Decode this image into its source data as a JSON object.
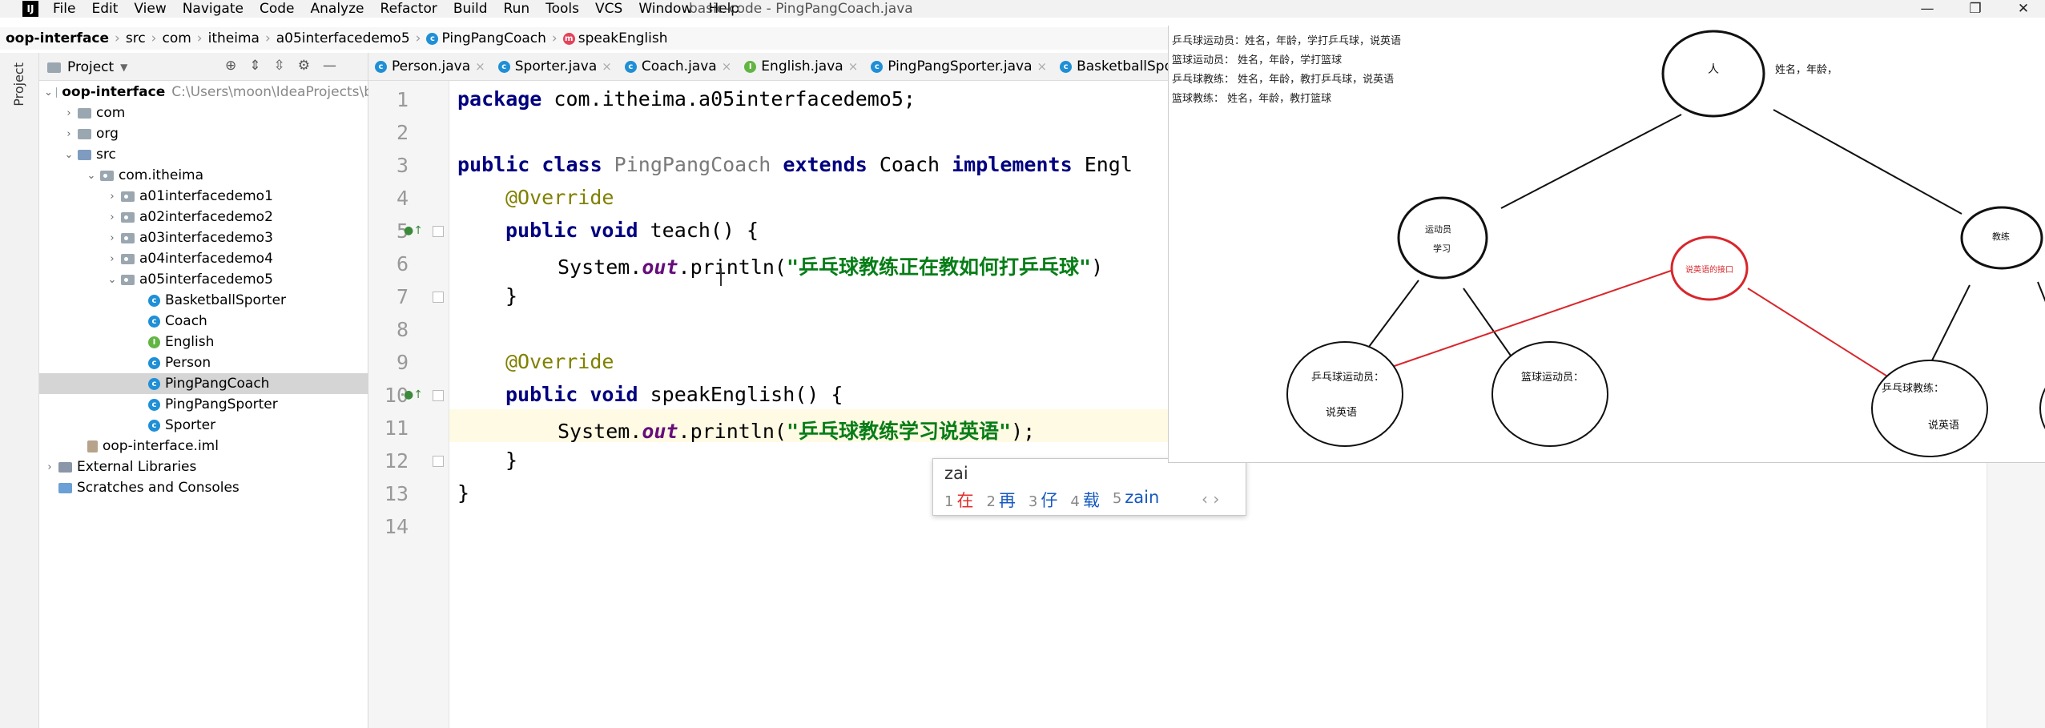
{
  "window": {
    "title": "basic-code - PingPangCoach.java",
    "menus": [
      "File",
      "Edit",
      "View",
      "Navigate",
      "Code",
      "Analyze",
      "Refactor",
      "Build",
      "Run",
      "Tools",
      "VCS",
      "Window",
      "Help"
    ]
  },
  "breadcrumb": [
    "oop-interface",
    "src",
    "com",
    "itheima",
    "a05interfacedemo5",
    "PingPangCoach",
    "speakEnglish"
  ],
  "side_stripe": {
    "label": "Project"
  },
  "project": {
    "title": "Project",
    "tree": [
      {
        "label": "oop-interface",
        "path": "C:\\Users\\moon\\IdeaProjects\\b"
      },
      {
        "label": "com"
      },
      {
        "label": "org"
      },
      {
        "label": "src"
      },
      {
        "label": "com.itheima"
      },
      {
        "label": "a01interfacedemo1"
      },
      {
        "label": "a02interfacedemo2"
      },
      {
        "label": "a03interfacedemo3"
      },
      {
        "label": "a04interfacedemo4"
      },
      {
        "label": "a05interfacedemo5"
      },
      {
        "label": "BasketballSporter"
      },
      {
        "label": "Coach"
      },
      {
        "label": "English"
      },
      {
        "label": "Person"
      },
      {
        "label": "PingPangCoach"
      },
      {
        "label": "PingPangSporter"
      },
      {
        "label": "Sporter"
      },
      {
        "label": "oop-interface.iml"
      },
      {
        "label": "External Libraries"
      },
      {
        "label": "Scratches and Consoles"
      }
    ]
  },
  "tabs": [
    "Person.java",
    "Sporter.java",
    "Coach.java",
    "English.java",
    "PingPangSporter.java",
    "BasketballSporte"
  ],
  "code": {
    "line_numbers": [
      "1",
      "2",
      "3",
      "4",
      "5",
      "6",
      "7",
      "8",
      "9",
      "10",
      "11",
      "12",
      "13",
      "14"
    ],
    "l1": {
      "kw": "package",
      "rest": " com.itheima.a05interfacedemo5;"
    },
    "l3": {
      "kw1": "public class ",
      "cls": "PingPangCoach",
      "kw2": " extends ",
      "t1": "Coach",
      "kw3": " implements ",
      "t2": "Engl"
    },
    "l4": "@Override",
    "l5": {
      "kw": "public void ",
      "rest": "teach() {"
    },
    "l6": {
      "a": "System.",
      "fld": "out",
      "b": ".println(",
      "str": "\"乒乓球教练正在教如何打乒乓球\"",
      "c": ")"
    },
    "l7": "}",
    "l9": "@Override",
    "l10": {
      "kw": "public void ",
      "rest": "speakEnglish() {"
    },
    "l11": {
      "a": "System.",
      "fld": "out",
      "b": ".println(",
      "str": "\"乒乓球教练学习说英语\"",
      "c": ");"
    },
    "l12": "}",
    "l13": "}"
  },
  "ime": {
    "input": "zai",
    "candidates": [
      {
        "num": "1",
        "text": "在"
      },
      {
        "num": "2",
        "text": "再"
      },
      {
        "num": "3",
        "text": "仔"
      },
      {
        "num": "4",
        "text": "载"
      },
      {
        "num": "5",
        "text": "zain"
      }
    ],
    "nav": "‹ ›"
  },
  "diagram": {
    "notes": [
      "乒乓球运动员：姓名，年龄，学打乒乓球，说英语",
      "篮球运动员：   姓名，年龄，学打篮球",
      "乒乓球教练：   姓名，年龄，教打乒乓球，说英语",
      "篮球教练：      姓名，年龄，教打篮球"
    ],
    "root": "人",
    "root_attr": "姓名，年龄，",
    "athlete": "运动员",
    "athlete_sub": "学习",
    "coach": "教练",
    "interface": "说英语的接口",
    "pp_athlete": "乒乓球运动员：",
    "pp_athlete_sub": "说英语",
    "bb_athlete": "篮球运动员：",
    "pp_coach": "乒乓球教练：",
    "pp_coach_sub": "说英语"
  },
  "colors": {
    "interface_red": "#d8262c",
    "keyword": "#000080",
    "string": "#067d17"
  }
}
